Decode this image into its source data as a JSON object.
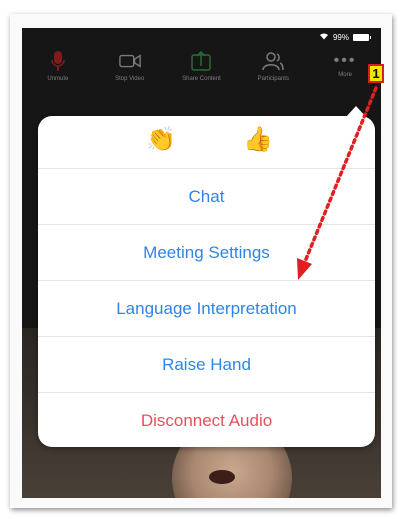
{
  "status_bar": {
    "battery": "99%"
  },
  "toolbar": {
    "items": [
      {
        "label": "Unmute",
        "icon": "microphone-icon",
        "color": "#d32020"
      },
      {
        "label": "Stop Video",
        "icon": "video-camera-icon",
        "color": "#cfcfcf"
      },
      {
        "label": "Share Content",
        "icon": "share-screen-icon",
        "color": "#37b24d"
      },
      {
        "label": "Participants",
        "icon": "participants-icon",
        "color": "#cfcfcf"
      },
      {
        "label": "More",
        "icon": "more-dots-icon",
        "color": "#cfcfcf"
      }
    ]
  },
  "reactions": [
    {
      "emoji": "👏",
      "icon": "clap-icon"
    },
    {
      "emoji": "👍",
      "icon": "thumbs-up-icon"
    }
  ],
  "menu": {
    "chat": "Chat",
    "meeting_settings": "Meeting Settings",
    "language_interpretation": "Language Interpretation",
    "raise_hand": "Raise Hand",
    "disconnect_audio": "Disconnect Audio"
  },
  "annotation": {
    "badge_number": "1",
    "arrow_color": "#e02020"
  },
  "colors": {
    "accent": "#2f84e8",
    "danger": "#e7505a",
    "badge_fill": "#f3e600"
  }
}
